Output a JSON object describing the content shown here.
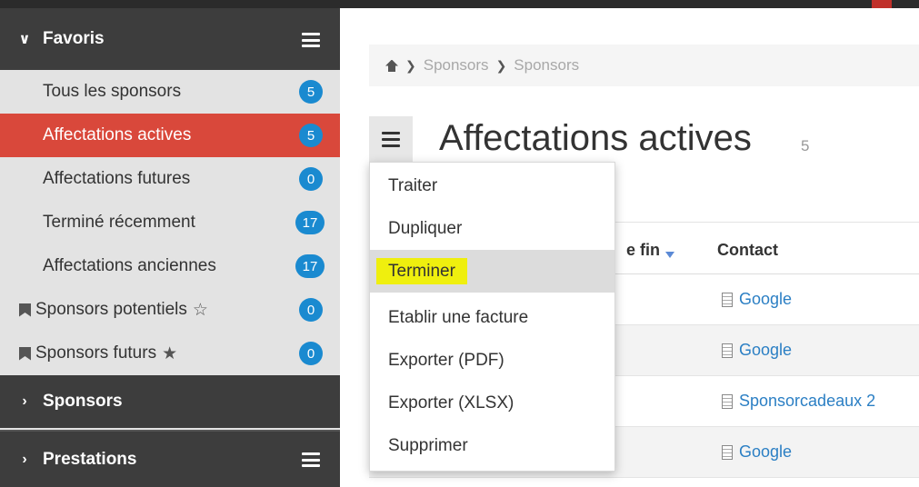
{
  "sidebar": {
    "favoris": {
      "label": "Favoris"
    },
    "items": [
      {
        "label": "Tous les sponsors",
        "count": "5"
      },
      {
        "label": "Affectations actives",
        "count": "5"
      },
      {
        "label": "Affectations futures",
        "count": "0"
      },
      {
        "label": "Terminé récemment",
        "count": "17"
      },
      {
        "label": "Affectations anciennes",
        "count": "17"
      },
      {
        "label": "Sponsors potentiels",
        "count": "0",
        "icon": "bookmark-icon",
        "star_icon": "star-outline-icon"
      },
      {
        "label": "Sponsors futurs",
        "count": "0",
        "icon": "bookmark-icon",
        "star_icon": "star-filled-icon"
      }
    ],
    "sections": [
      {
        "label": "Sponsors"
      },
      {
        "label": "Prestations"
      }
    ]
  },
  "breadcrumb": {
    "items": [
      "Sponsors",
      "Sponsors"
    ]
  },
  "page": {
    "title": "Affectations actives",
    "count": "5"
  },
  "table": {
    "headers": {
      "date_fin": "e fin",
      "contact": "Contact"
    },
    "rows": [
      {
        "contact": "Google"
      },
      {
        "contact": "Google"
      },
      {
        "contact": "Sponsorcadeaux 2"
      },
      {
        "contact": "Google"
      }
    ]
  },
  "dropdown": {
    "items": [
      "Traiter",
      "Dupliquer",
      "Terminer",
      "Etablir une facture",
      "Exporter (PDF)",
      "Exporter (XLSX)",
      "Supprimer"
    ],
    "highlighted_index": 2
  },
  "colors": {
    "active": "#d9483b",
    "badge": "#1a8ad0",
    "link": "#2b7fc4",
    "highlight": "#efef0e",
    "sidebar_header": "#3d3d3d"
  }
}
